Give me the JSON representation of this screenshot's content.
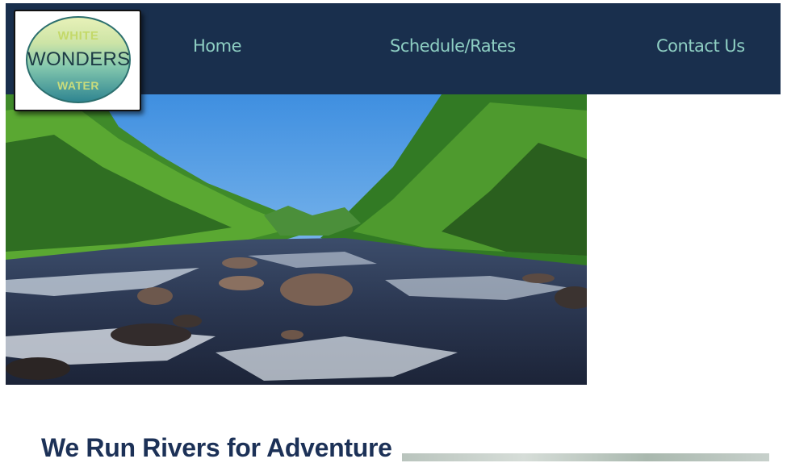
{
  "logo": {
    "line1": "WHITE",
    "line2": "WONDERS",
    "line3": "WATER"
  },
  "nav": {
    "home": "Home",
    "schedule": "Schedule/Rates",
    "contact": "Contact Us"
  },
  "colors": {
    "header_bg": "#192f4d",
    "nav_text": "#8ecfc3",
    "headline": "#1c3157"
  },
  "main": {
    "headline": "We Run Rivers for Adventure"
  }
}
